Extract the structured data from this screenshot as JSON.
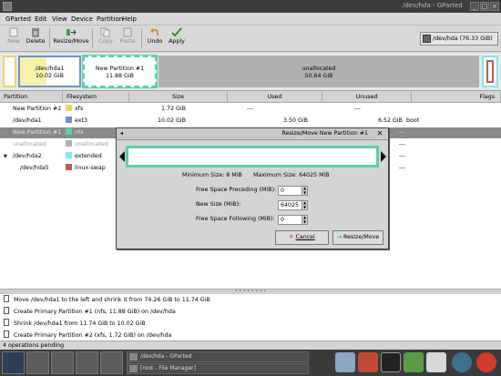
{
  "window": {
    "title": "/dev/hda - GParted"
  },
  "menu": [
    "GParted",
    "Edit",
    "View",
    "Device",
    "Partition",
    "Help"
  ],
  "toolbar": {
    "new": "New",
    "delete": "Delete",
    "resize_move": "Resize/Move",
    "copy": "Copy",
    "paste": "Paste",
    "undo": "Undo",
    "apply": "Apply",
    "device": "/dev/hda",
    "device_size": "(76.33 GiB)"
  },
  "graph": {
    "hda1_name": "/dev/hda1",
    "hda1_size": "10.02 GiB",
    "new1_name": "New Partition #1",
    "new1_size": "11.88 GiB",
    "unalloc_name": "unallocated",
    "unalloc_size": "50.64 GiB"
  },
  "table": {
    "headers": [
      "Partition",
      "Filesystem",
      "Size",
      "Used",
      "Unused",
      "Flags"
    ],
    "rows": [
      {
        "partition": "New Partition #2",
        "fs": "xfs",
        "size": "1.72 GiB",
        "used": "---",
        "unused": "---",
        "flags": "",
        "color": "#f2d16b"
      },
      {
        "partition": "/dev/hda1",
        "fs": "ext3",
        "size": "10.02 GiB",
        "used": "3.50 GiB",
        "unused": "6.52 GiB",
        "flags": "boot",
        "color": "#6c91c9"
      },
      {
        "partition": "New Partition #1",
        "fs": "nfs",
        "size": "",
        "used": "",
        "unused": "---",
        "flags": "",
        "color": "#5dd0a4"
      },
      {
        "partition": "unallocated",
        "fs": "unallocated",
        "size": "",
        "used": "",
        "unused": "---",
        "flags": "",
        "color": "#b0b0b0"
      },
      {
        "partition": "/dev/hda2",
        "fs": "extended",
        "size": "",
        "used": "",
        "unused": "---",
        "flags": "",
        "color": "#7fe7f0"
      },
      {
        "partition": "/dev/hda5",
        "fs": "linux-swap",
        "size": "",
        "used": "",
        "unused": "---",
        "flags": "",
        "color": "#c15b55"
      }
    ]
  },
  "dialog": {
    "title": "Resize/Move New Partition #1",
    "min_size": "Minimum Size: 8 MiB",
    "max_size": "Maximum Size: 64025 MiB",
    "preceding_label": "Free Space Preceding (MiB):",
    "preceding_value": "0",
    "newsize_label": "New Size (MiB):",
    "newsize_value": "64025",
    "following_label": "Free Space Following (MiB):",
    "following_value": "0",
    "cancel": "Cancel",
    "resize": "Resize/Move"
  },
  "operations": [
    "Move /dev/hda1 to the left and shrink it from 74.26 GiB to 11.74 GiB",
    "Create Primary Partition #1 (nfs, 11.88 GiB) on /dev/hda",
    "Shrink /dev/hda1 from 11.74 GiB to 10.02 GiB",
    "Create Primary Partition #2 (xfs, 1.72 GiB) on /dev/hda"
  ],
  "status": "4 operations pending",
  "taskbar": {
    "task1": "/dev/hda - GParted",
    "task2": "[root - File Manager]"
  }
}
